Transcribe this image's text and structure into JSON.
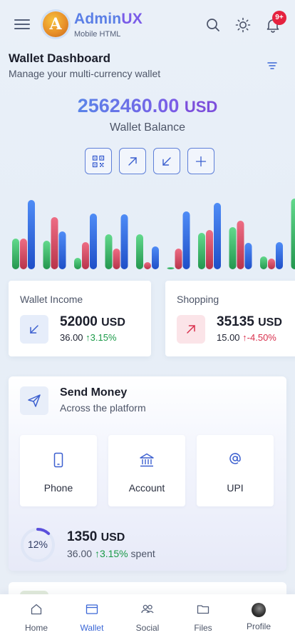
{
  "app": {
    "name_part1": "Admin",
    "name_part2": "UX",
    "subtitle": "Mobile HTML",
    "logo_letter": "A"
  },
  "header": {
    "notification_badge": "9+"
  },
  "page": {
    "title": "Wallet Dashboard",
    "subtitle": "Manage your multi-currency wallet"
  },
  "balance": {
    "amount": "2562460.00",
    "currency": "USD",
    "label": "Wallet Balance"
  },
  "chart_data": {
    "type": "bar",
    "categories": [
      "1",
      "2",
      "3",
      "4",
      "5",
      "6",
      "7",
      "8",
      "9",
      "10"
    ],
    "series": [
      {
        "color": "#3fb56a",
        "values": [
          43,
          40,
          16,
          49,
          49,
          3,
          51,
          59,
          18,
          99
        ]
      },
      {
        "color": "#d94a63",
        "values": [
          43,
          73,
          38,
          29,
          10,
          29,
          55,
          68,
          15,
          15
        ]
      },
      {
        "color": "#2f6ee6",
        "values": [
          97,
          53,
          78,
          77,
          32,
          81,
          93,
          37,
          38,
          15
        ]
      }
    ],
    "colors": {
      "green": "#3fb56a",
      "red": "#d94a63",
      "blue": "#2f6ee6"
    }
  },
  "cards": [
    {
      "label": "Wallet Income",
      "value": "52000",
      "currency": "USD",
      "amount": "36.00",
      "change": "↑3.15%"
    },
    {
      "label": "Shopping",
      "value": "35135",
      "currency": "USD",
      "amount": "15.00",
      "change": "↑-4.50%"
    }
  ],
  "send_money": {
    "title": "Send Money",
    "subtitle": "Across the platform",
    "options": [
      {
        "label": "Phone"
      },
      {
        "label": "Account"
      },
      {
        "label": "UPI"
      }
    ],
    "progress_percent": 12,
    "progress_text": "12%",
    "spent_value": "1350",
    "spent_currency": "USD",
    "spent_amount": "36.00",
    "spent_change": "↑3.15%",
    "spent_suffix": "spent"
  },
  "nav": [
    {
      "label": "Home"
    },
    {
      "label": "Wallet"
    },
    {
      "label": "Social"
    },
    {
      "label": "Files"
    },
    {
      "label": "Profile"
    }
  ]
}
